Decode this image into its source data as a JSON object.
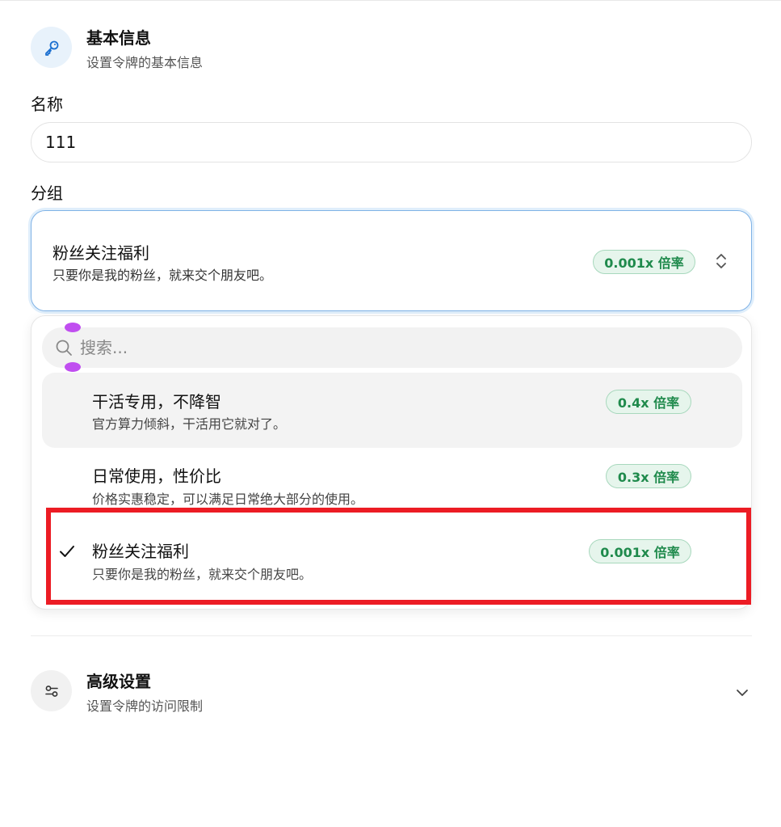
{
  "basic_section": {
    "icon": "key-icon",
    "title": "基本信息",
    "subtitle": "设置令牌的基本信息"
  },
  "name_field": {
    "label": "名称",
    "value": "111"
  },
  "group_field": {
    "label": "分组",
    "selected": {
      "title": "粉丝关注福利",
      "description": "只要你是我的粉丝，就来交个朋友吧。",
      "badge": "0.001x 倍率"
    }
  },
  "dropdown": {
    "search_placeholder": "搜索...",
    "options": [
      {
        "title": "干活专用，不降智",
        "description": "官方算力倾斜，干活用它就对了。",
        "badge": "0.4x 倍率",
        "highlighted": true,
        "selected": false
      },
      {
        "title": "日常使用，性价比",
        "description": "价格实惠稳定，可以满足日常绝大部分的使用。",
        "badge": "0.3x 倍率",
        "highlighted": false,
        "selected": false
      },
      {
        "title": "粉丝关注福利",
        "description": "只要你是我的粉丝，就来交个朋友吧。",
        "badge": "0.001x 倍率",
        "highlighted": false,
        "selected": true
      }
    ]
  },
  "advanced_section": {
    "icon": "sliders-icon",
    "title": "高级设置",
    "subtitle": "设置令牌的访问限制"
  },
  "colors": {
    "accent_blue": "#1a6fd0",
    "badge_green": "#1f8a4c",
    "annotation_red": "#ec1c24"
  }
}
